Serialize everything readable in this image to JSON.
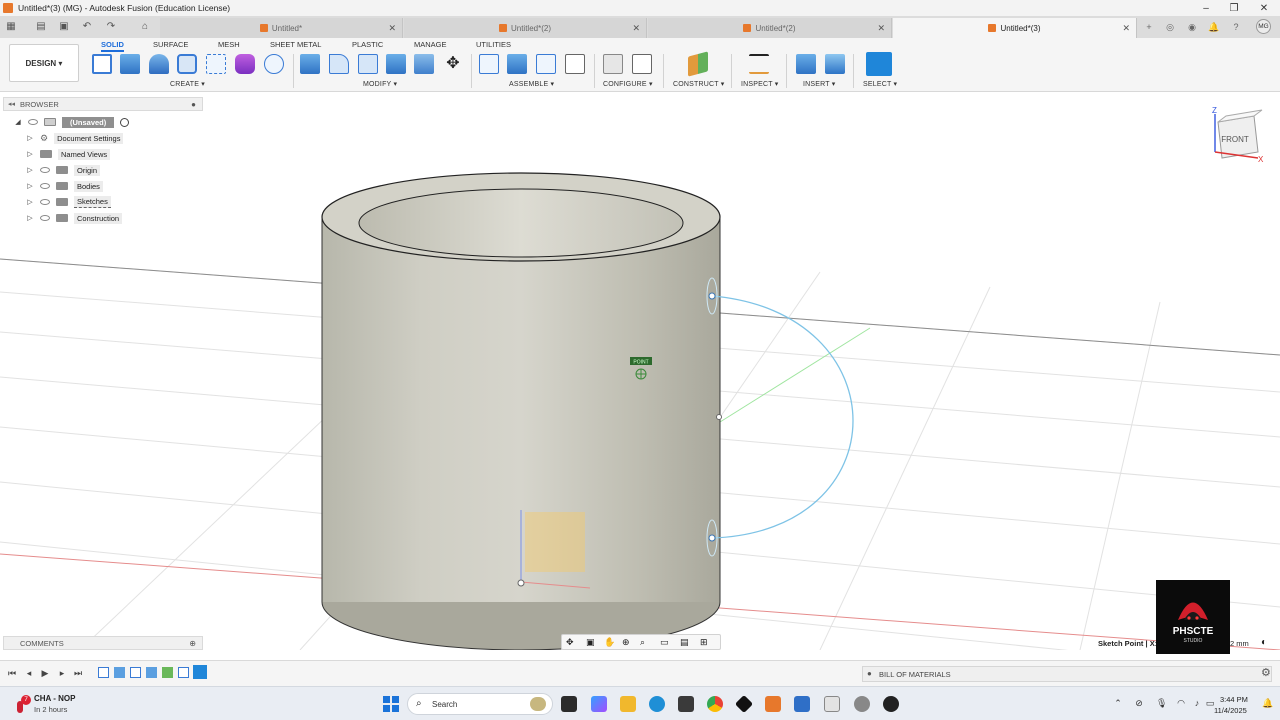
{
  "window": {
    "title": "Untitled*(3) (MG) - Autodesk Fusion (Education License)"
  },
  "tabs": [
    {
      "label": "Untitled*"
    },
    {
      "label": "Untitled*(2)"
    },
    {
      "label": "Untitled*(2)"
    },
    {
      "label": "Untitled*(3)"
    }
  ],
  "user": {
    "initials": "MG"
  },
  "ribbon": {
    "design_label": "DESIGN ▾",
    "tabs": [
      "SOLID",
      "SURFACE",
      "MESH",
      "SHEET METAL",
      "PLASTIC",
      "MANAGE",
      "UTILITIES"
    ],
    "groups": [
      "CREATE ▾",
      "MODIFY ▾",
      "ASSEMBLE ▾",
      "CONFIGURE ▾",
      "CONSTRUCT ▾",
      "INSPECT ▾",
      "INSERT ▾",
      "SELECT ▾"
    ]
  },
  "browser": {
    "title": "BROWSER",
    "items": [
      {
        "label": "(Unsaved)"
      },
      {
        "label": "Document Settings"
      },
      {
        "label": "Named Views"
      },
      {
        "label": "Origin"
      },
      {
        "label": "Bodies"
      },
      {
        "label": "Sketches"
      },
      {
        "label": "Construction"
      }
    ]
  },
  "viewport": {
    "viewcube_label": "FRONT",
    "axis_z": "Z",
    "axis_x": "X",
    "point_tag": "POINT"
  },
  "comments": {
    "label": "COMMENTS"
  },
  "status": {
    "text": "Sketch Point | X:",
    "unit": "2 mm"
  },
  "bom": {
    "label": "BILL OF MATERIALS"
  },
  "logo": {
    "line1": "PHSCTE",
    "line2": "STUDIO"
  },
  "taskbar": {
    "weather_badge": "7",
    "weather_title": "CHA - NOP",
    "weather_sub": "In 2 hours",
    "search_placeholder": "Search",
    "time": "3:44 PM",
    "date": "11/4/2025"
  },
  "colors": {
    "accent": "#1d6ddb",
    "fusion_orange": "#e7782c",
    "body_fill": "#c9c8bd",
    "sketch_blue": "#7ec3e6"
  }
}
